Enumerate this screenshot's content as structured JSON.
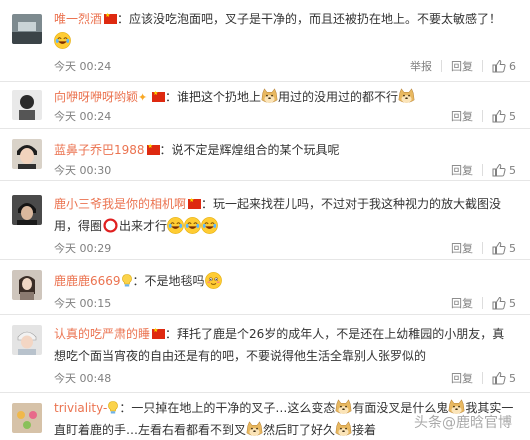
{
  "comments": [
    {
      "user": "唯一烈酒",
      "text_a": "：应该没吃泡面吧，叉子是干净的，而且还被扔在地上。不要太敏感了！",
      "time": "今天 00:24",
      "report": "举报",
      "reply": "回复",
      "likes": "6"
    },
    {
      "user": "向咿呀咿呀哟颖",
      "text_a": "：谁把这个扔地上",
      "text_b": "用过的没用过的都不行",
      "time": "今天 00:24",
      "reply": "回复",
      "likes": "5"
    },
    {
      "user": "蓝鼻子乔巴1988",
      "text_a": "：说不定是辉煌组合的某个玩具呢",
      "time": "今天 00:30",
      "reply": "回复",
      "likes": "5"
    },
    {
      "user": "鹿小三爷我是你的相机啊",
      "text_a": "：玩一起来找茬儿吗，不过对于我这种视力的放大截图没",
      "text_b": "用，得圈",
      "text_c": "出来才行",
      "time": "今天 00:29",
      "reply": "回复",
      "likes": "5"
    },
    {
      "user": "鹿鹿鹿6669",
      "text_a": "：不是地毯吗",
      "time": "今天 00:15",
      "reply": "回复",
      "likes": "5"
    },
    {
      "user": "认真的吃严肃的睡",
      "text_a": "：拜托了鹿是个26岁的成年人，不是还在上幼稚园的小朋友，真",
      "text_b": "想吃个面当宵夜的自由还是有的吧，不要说得他生活全靠别人张罗似的",
      "time": "今天 00:48",
      "reply": "回复",
      "likes": "5"
    },
    {
      "user": "triviality-",
      "text_a": "：一只掉在地上的干净的叉子…这么变态",
      "text_b": "有面没叉是什么鬼",
      "text_c": "我其实一",
      "text_d": "直盯着鹿的手…左看右看都看不到叉",
      "text_e": "然后盯了好久",
      "text_f": "接着"
    }
  ],
  "watermark": "头条@鹿晗官博",
  "colors": {
    "username": "#eb7350",
    "meta": "#808080",
    "divider": "#e6e6e6",
    "flag": "#de2910"
  },
  "icons": [
    "thumbs-up-icon",
    "laugh-cry-emoji",
    "doge-emoji",
    "red-circle-emoji",
    "shy-smile-emoji",
    "bulb-icon",
    "china-flag-icon",
    "sparkle-icon"
  ]
}
